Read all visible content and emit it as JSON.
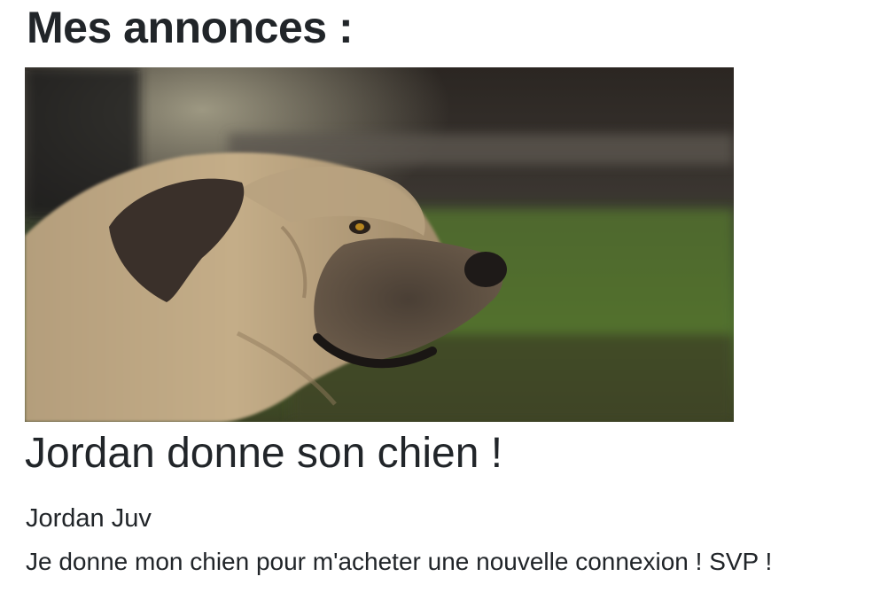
{
  "page": {
    "title": "Mes annonces :"
  },
  "listings": [
    {
      "photo": {
        "alt": "dog-photo",
        "subject": "tan mastiff dog in profile"
      },
      "title": "Jordan donne son chien !",
      "author": "Jordan Juv",
      "description": "Je donne mon chien pour m'acheter une nouvelle connexion ! SVP !"
    }
  ]
}
